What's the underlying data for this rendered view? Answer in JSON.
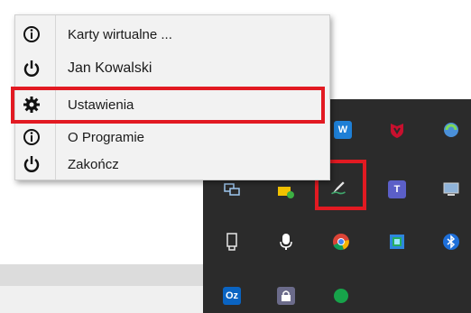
{
  "context_menu": {
    "items": [
      {
        "label": "Karty wirtualne ...",
        "icon": "info-icon"
      },
      {
        "label": "Jan Kowalski",
        "icon": "power-icon"
      },
      {
        "label": "Ustawienia",
        "icon": "gear-icon"
      },
      {
        "label": "O Programie",
        "icon": "info-icon"
      },
      {
        "label": "Zakończ",
        "icon": "power-icon"
      }
    ]
  },
  "tray_overflow": {
    "icons": [
      {
        "name": "waves-app-icon",
        "text": "W"
      },
      {
        "name": "mcafee-shield-icon"
      },
      {
        "name": "sync-globe-icon"
      },
      {
        "name": "network-monitor-icon"
      },
      {
        "name": "battery-plug-icon"
      },
      {
        "name": "signature-pen-icon"
      },
      {
        "name": "teams-icon",
        "text": "T"
      },
      {
        "name": "display-monitor-icon"
      },
      {
        "name": "usb-drive-icon"
      },
      {
        "name": "microphone-icon"
      },
      {
        "name": "chrome-icon"
      },
      {
        "name": "network-adapter-icon"
      },
      {
        "name": "bluetooth-icon"
      },
      {
        "name": "outlook-icon",
        "text": "Oz"
      },
      {
        "name": "lock-app-icon"
      },
      {
        "name": "green-status-icon"
      }
    ]
  },
  "annotation_color": "#e21a22"
}
